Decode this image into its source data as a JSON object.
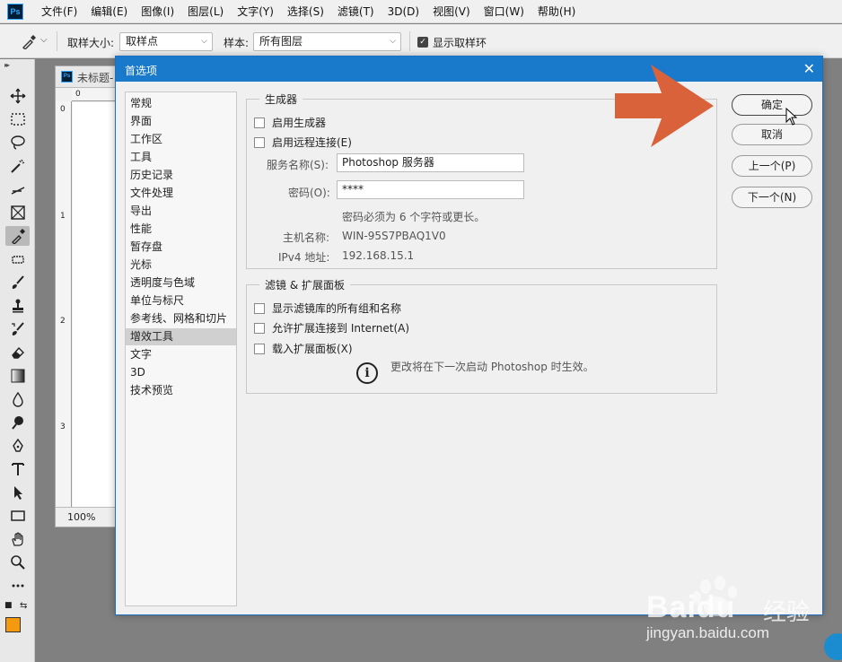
{
  "app": {
    "logo": "Ps"
  },
  "menu": [
    "文件(F)",
    "编辑(E)",
    "图像(I)",
    "图层(L)",
    "文字(Y)",
    "选择(S)",
    "滤镜(T)",
    "3D(D)",
    "视图(V)",
    "窗口(W)",
    "帮助(H)"
  ],
  "options": {
    "sample_size_label": "取样大小:",
    "sample_size_value": "取样点",
    "sample_label": "样本:",
    "sample_value": "所有图层",
    "show_ring_label": "显示取样环"
  },
  "document": {
    "title": "未标题-",
    "zoom": "100%",
    "ruler_top": [
      "0"
    ],
    "ruler_left": [
      "0",
      "1",
      "2",
      "3"
    ]
  },
  "dialog": {
    "title": "首选项",
    "categories": [
      "常规",
      "界面",
      "工作区",
      "工具",
      "历史记录",
      "文件处理",
      "导出",
      "性能",
      "暂存盘",
      "光标",
      "透明度与色域",
      "单位与标尺",
      "参考线、网格和切片",
      "增效工具",
      "文字",
      "3D",
      "技术预览"
    ],
    "selected_category": "增效工具",
    "generator": {
      "title": "生成器",
      "enable_generator": "启用生成器",
      "enable_remote": "启用远程连接(E)",
      "service_name_label": "服务名称(S):",
      "service_name_value": "Photoshop 服务器",
      "password_label": "密码(O):",
      "password_value": "****",
      "password_hint": "密码必须为 6 个字符或更长。",
      "host_label": "主机名称:",
      "host_value": "WIN-95S7PBAQ1V0",
      "ipv4_label": "IPv4 地址:",
      "ipv4_value": "192.168.15.1"
    },
    "filters": {
      "title": "滤镜 & 扩展面板",
      "show_all_filters": "显示滤镜库的所有组和名称",
      "allow_extensions": "允许扩展连接到 Internet(A)",
      "load_panels": "载入扩展面板(X)",
      "restart_note": "更改将在下一次启动 Photoshop 时生效。"
    },
    "buttons": {
      "ok": "确定",
      "cancel": "取消",
      "prev": "上一个(P)",
      "next": "下一个(N)"
    }
  },
  "colors": {
    "foreground": "#f59a0f",
    "background": "#ffffff",
    "titlebar": "#1979ca",
    "annotation_arrow": "#d9623a"
  },
  "watermark": {
    "brand": "Baidu",
    "brand_cn": "经验",
    "url": "jingyan.baidu.com"
  }
}
